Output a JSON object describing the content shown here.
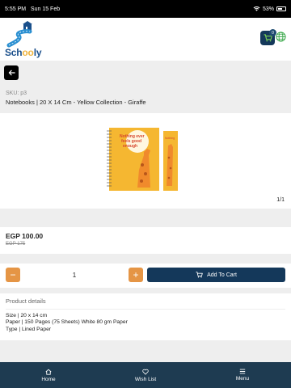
{
  "status": {
    "time": "5:55 PM",
    "date": "Sun 15 Feb",
    "battery": "53%"
  },
  "header": {
    "logo_text_part1": "Sch",
    "logo_text_o": "oo",
    "logo_text_part2": "ly",
    "cart_count": "0"
  },
  "product": {
    "sku": "SKU: p3",
    "title": "Notebooks | 20 X 14 Cm - Yellow Collection - Giraffe",
    "image_counter": "1/1",
    "price": "EGP 100.00",
    "old_price": "EGP 175",
    "quantity": "1",
    "minus_label": "−",
    "plus_label": "+",
    "add_to_cart_label": "Add To Cart",
    "notebook_text": "Nothing ever feels good enough"
  },
  "details": {
    "title": "Product details",
    "lines": [
      "Size | 20 x 14 cm",
      "Paper | 150 Pages (75 Sheets) White 80 gm Paper",
      "Type | Lined Paper"
    ]
  },
  "nav": {
    "items": [
      {
        "label": "Home"
      },
      {
        "label": "Wish List"
      },
      {
        "label": "Menu"
      }
    ]
  },
  "colors": {
    "primary": "#14385a",
    "accent": "#e59545",
    "nav": "#1e3b51"
  },
  "icons": [
    "wifi-icon",
    "battery-icon",
    "cart-icon",
    "globe-icon",
    "arrow-left-icon",
    "home-icon",
    "heart-icon",
    "menu-icon"
  ]
}
